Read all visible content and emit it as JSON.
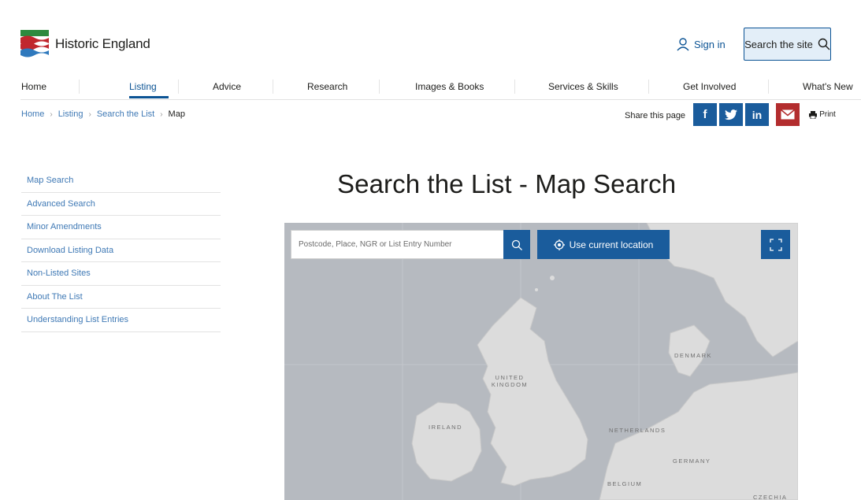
{
  "site": {
    "name": "Historic England"
  },
  "header": {
    "signin_label": "Sign in",
    "search_label": "Search the site"
  },
  "nav": {
    "items": [
      {
        "label": "Home"
      },
      {
        "label": "Listing"
      },
      {
        "label": "Advice"
      },
      {
        "label": "Research"
      },
      {
        "label": "Images & Books"
      },
      {
        "label": "Services & Skills"
      },
      {
        "label": "Get Involved"
      },
      {
        "label": "What's New"
      }
    ],
    "active": "Listing"
  },
  "breadcrumb": [
    {
      "label": "Home"
    },
    {
      "label": "Listing"
    },
    {
      "label": "Search the List"
    },
    {
      "label": "Map"
    }
  ],
  "share": {
    "label": "Share this page",
    "print_label": "Print"
  },
  "sidebar": {
    "items": [
      {
        "label": "Map Search"
      },
      {
        "label": "Advanced Search"
      },
      {
        "label": "Minor Amendments"
      },
      {
        "label": "Download Listing Data"
      },
      {
        "label": "Non-Listed Sites"
      },
      {
        "label": "About The List"
      },
      {
        "label": "Understanding List Entries"
      }
    ]
  },
  "page": {
    "title": "Search the List - Map Search"
  },
  "map": {
    "search_placeholder": "Postcode, Place, NGR or List Entry Number",
    "locate_label": "Use current location",
    "labels": {
      "uk": "UNITED KINGDOM",
      "ireland": "IRELAND",
      "denmark": "DENMARK",
      "netherlands": "NETHERLANDS",
      "germany": "GERMANY",
      "belgium": "BELGIUM",
      "czechia": "CZECHIA"
    }
  },
  "colors": {
    "brand_blue": "#1a5c9c",
    "link_blue": "#3f79b5",
    "email_red": "#b32d2e",
    "search_bg": "#e3eef8",
    "sea": "#b6bac0",
    "land": "#dcdcdc"
  }
}
